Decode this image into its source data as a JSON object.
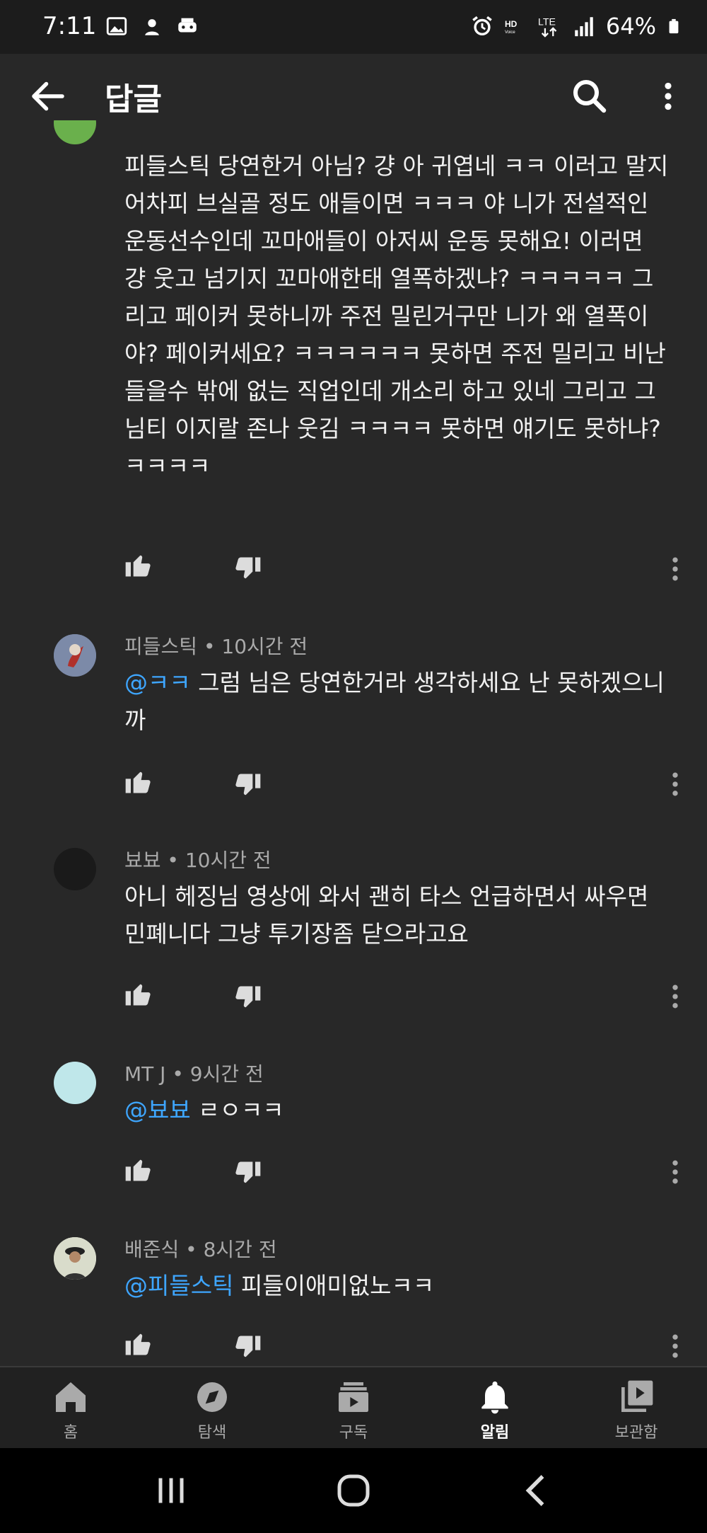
{
  "status": {
    "time": "7:11",
    "battery": "64%"
  },
  "header": {
    "title": "답글"
  },
  "partial_comment": {
    "text": "피들스틱 당연한거 아님? 걍 아 귀엽네 ㅋㅋ 이러고 말지 어차피 브실골 정도 애들이면 ㅋㅋㅋ 야 니가 전설적인 운동선수인데 꼬마애들이 아저씨 운동 못해요! 이러면 걍 웃고 넘기지 꼬마애한태 열폭하겠냐? ㅋㅋㅋㅋㅋ 그리고 페이커 못하니까 주전 밀린거구만 니가 왜 열폭이야? 페이커세요? ㅋㅋㅋㅋㅋㅋ 못하면 주전 밀리고 비난 들을수 밖에 없는 직업인데 개소리 하고 있네 그리고 그님티 이지랄 존나 웃김 ㅋㅋㅋㅋ 못하면 얘기도 못하냐? ㅋㅋㅋㅋ",
    "avatar_color": "#6ab04c"
  },
  "comments": [
    {
      "author": "피들스틱",
      "time": "10시간 전",
      "mention": "@ㅋㅋ",
      "text": " 그럼 님은 당연한거라 생각하세요 난 못하겠으니까",
      "avatar_color": "#5b6b8a"
    },
    {
      "author": "뵤뵤",
      "time": "10시간 전",
      "mention": "",
      "text": "아니 헤징님 영상에 와서 괜히 타스 언급하면서 싸우면 민폐니다 그냥 투기장좀 닫으라고요",
      "avatar_color": "#1a1a1a"
    },
    {
      "author": "MT J",
      "time": "9시간 전",
      "mention": "@뵤뵤",
      "text": " ㄹㅇㅋㅋ",
      "avatar_color": "#bfe7ea"
    },
    {
      "author": "배준식",
      "time": "8시간 전",
      "mention": "@피들스틱",
      "text": " 피들이애미없노ㅋㅋ",
      "avatar_color": "#e6e6d8"
    }
  ],
  "separator": " • ",
  "nav": {
    "items": [
      {
        "label": "홈",
        "icon": "home-icon"
      },
      {
        "label": "탐색",
        "icon": "explore-icon"
      },
      {
        "label": "구독",
        "icon": "subscriptions-icon"
      },
      {
        "label": "알림",
        "icon": "notifications-icon"
      },
      {
        "label": "보관함",
        "icon": "library-icon"
      }
    ],
    "active_index": 3
  },
  "colors": {
    "background": "#282828",
    "mention": "#3ea6ff",
    "text": "#f1f1f1",
    "meta": "#aaaaaa"
  }
}
